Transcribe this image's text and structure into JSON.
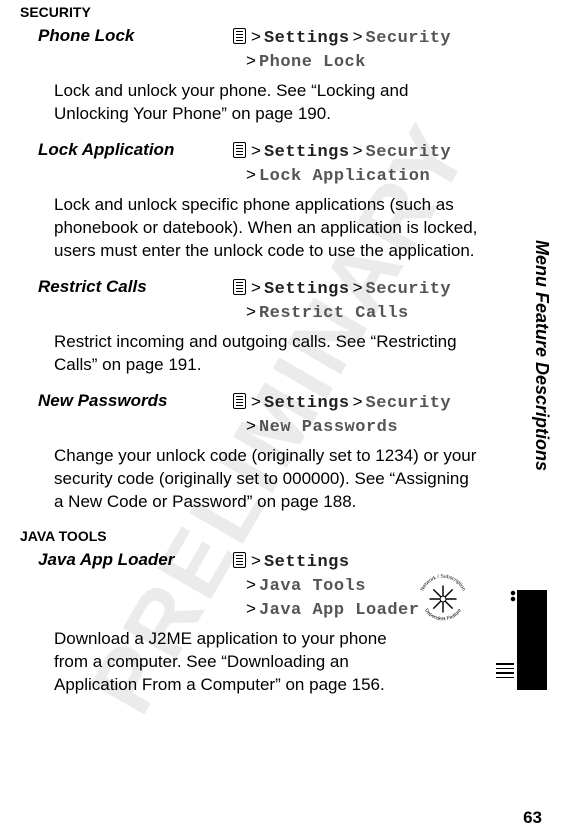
{
  "watermark": "PRELIMINARY",
  "side_title": "Menu Feature Descriptions",
  "page_number": "63",
  "sections": [
    {
      "heading": "SECURITY",
      "items": [
        {
          "title": "Phone Lock",
          "path_a1": "Settings",
          "path_a2": "Security",
          "path_b1": "Phone Lock",
          "desc": "Lock and unlock your phone. See “Locking and Unlocking Your Phone” on page 190."
        },
        {
          "title": "Lock Application",
          "path_a1": "Settings",
          "path_a2": "Security",
          "path_b1": "Lock Application",
          "desc": "Lock and unlock specific phone applications (such as phonebook or datebook). When an application is locked, users must enter the unlock code to use the application."
        },
        {
          "title": "Restrict Calls",
          "path_a1": "Settings",
          "path_a2": "Security",
          "path_b1": "Restrict Calls",
          "desc": "Restrict incoming and outgoing calls. See “Restricting Calls” on page 191."
        },
        {
          "title": "New Passwords",
          "path_a1": "Settings",
          "path_a2": "Security",
          "path_b1": "New Passwords",
          "desc": "Change your unlock code (originally set to 1234) or your security code (originally set to 000000). See “Assigning a New Code or Password” on page 188."
        }
      ]
    },
    {
      "heading": "JAVA TOOLS",
      "items": [
        {
          "title": "Java App Loader",
          "path_a1": "Settings",
          "path_b1": "Java Tools",
          "path_c1": "Java App Loader",
          "desc": "Download a J2ME application to your phone from a computer. See “Downloading an Application From a Computer” on page 156."
        }
      ]
    }
  ],
  "badge": {
    "top_text": "Network / Subscription",
    "bottom_text": "Dependent Feature"
  }
}
